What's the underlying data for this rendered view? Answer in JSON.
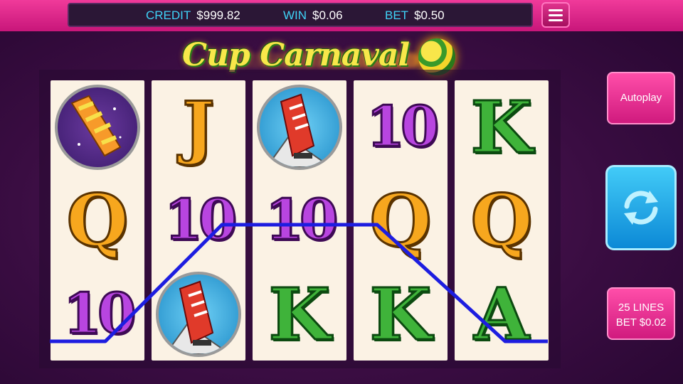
{
  "hud": {
    "credit_label": "CREDIT",
    "credit_value": "$999.82",
    "win_label": "WIN",
    "win_value": "$0.06",
    "bet_label": "BET",
    "bet_value": "$0.50"
  },
  "logo": {
    "title": "Cup Carnaval"
  },
  "reels": [
    [
      "wand",
      "J",
      "boot",
      "10",
      "K"
    ],
    [
      "Q",
      "10",
      "10",
      "Q",
      "Q"
    ],
    [
      "10",
      "boot",
      "K",
      "K",
      "A"
    ]
  ],
  "controls": {
    "autoplay_label": "Autoplay",
    "lines_label": "25 LINES",
    "line_bet_label": "BET $0.02"
  },
  "colors": {
    "accent_pink": "#e92b8c",
    "hud_label": "#3fd3f7",
    "payline": "#1d1de0",
    "spin_button": "#2aaef0"
  },
  "icons": {
    "menu": "hamburger-icon",
    "spin": "refresh-icon",
    "wand": "magic-wand-icon",
    "boot": "football-boot-icon",
    "ball": "football-icon"
  }
}
